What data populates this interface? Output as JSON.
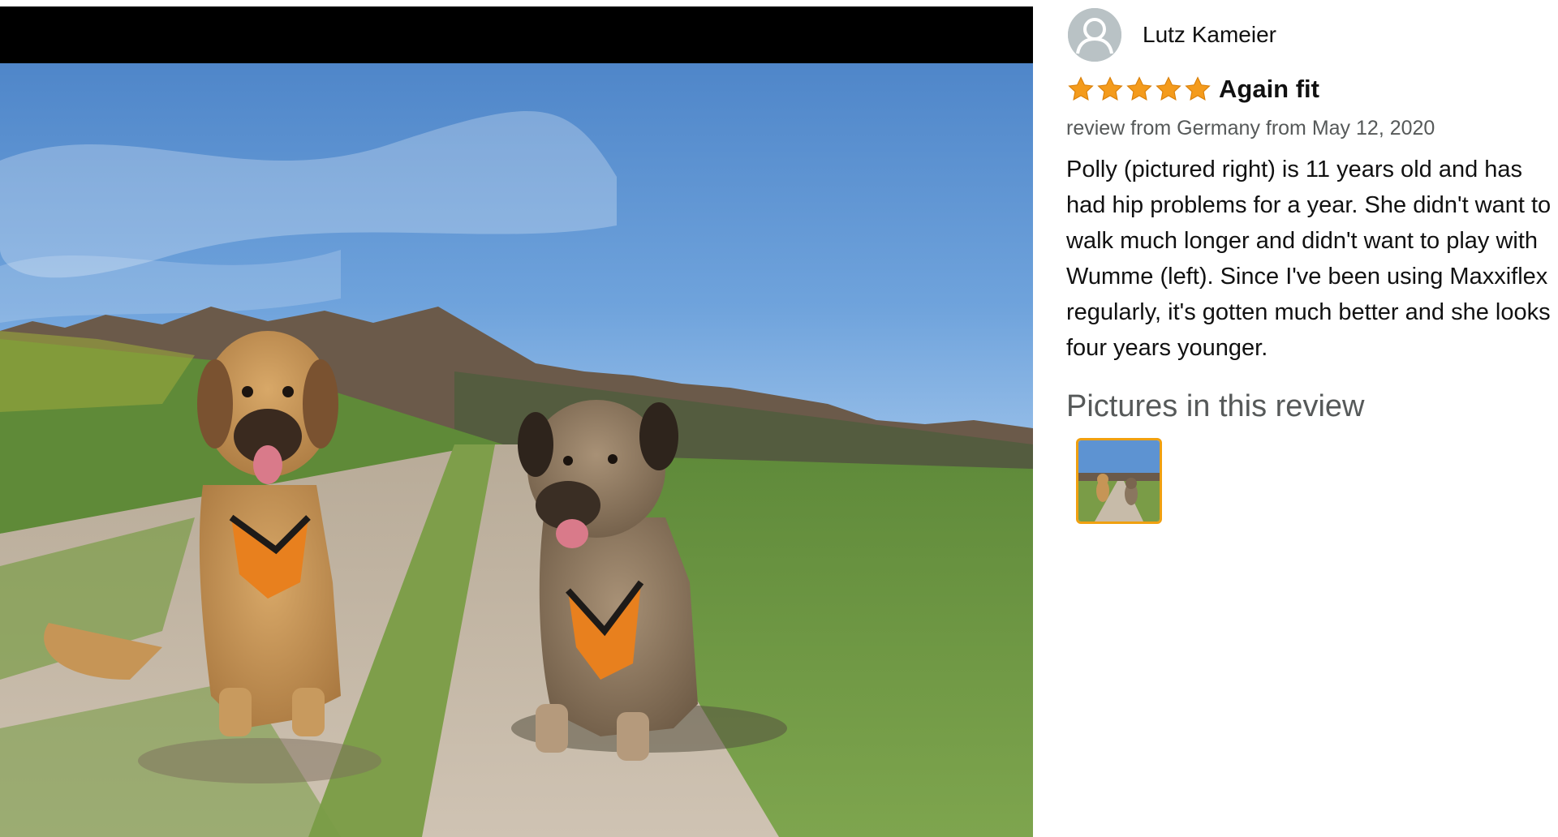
{
  "viewer": {
    "image_alt": "Two dogs wearing orange harnesses sitting on a field path"
  },
  "review": {
    "reviewer_name": "Lutz Kameier",
    "rating": 5,
    "rating_max": 5,
    "title": "Again fit",
    "meta": "review from Germany from May 12, 2020",
    "body": "Polly (pictured right) is 11 years old and has had hip problems for a year. She didn't want to walk much longer and didn't want to play with Wumme (left). Since I've been using Maxxiflex regularly, it's gotten much better and she looks four years younger.",
    "pictures_heading": "Pictures in this review",
    "pictures": [
      {
        "alt": "Two dogs on a field path"
      }
    ]
  },
  "colors": {
    "star": "#f49b1c",
    "thumb_border": "#f0a010",
    "meta_text": "#565959"
  },
  "icons": {
    "avatar": "user-silhouette-icon",
    "star": "star-filled-icon"
  }
}
